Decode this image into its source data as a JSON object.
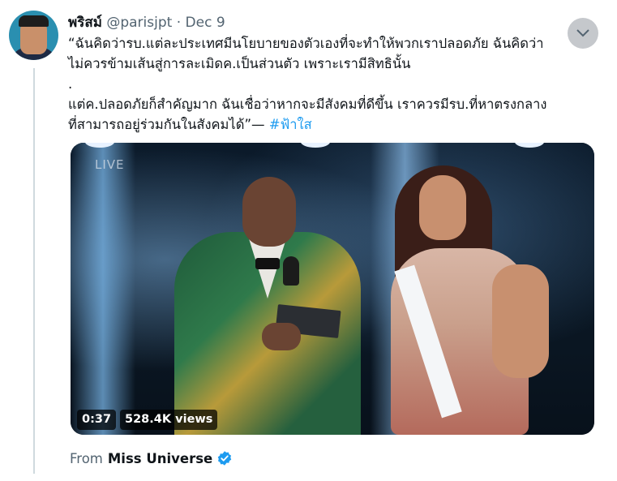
{
  "tweet": {
    "author_name": "พริสม์",
    "handle": "@parisjpt",
    "separator": "·",
    "date": "Dec 9",
    "lines": [
      "“ฉันคิดว่ารบ.แต่ละประเทศมีนโยบายของตัวเองที่จะทำให้พวกเราปลอดภัย ฉันคิดว่า",
      "ไม่ควรข้ามเส้นสู่การละเมิดค.เป็นส่วนตัว เพราะเรามีสิทธินั้น",
      ".",
      "แต่ค.ปลอดภัยก็สำคัญมาก ฉันเชื่อว่าหากจะมีสังคมที่ดีขึ้น เราควรมีรบ.ที่หาตรงกลาง"
    ],
    "last_line_text": "ที่สามารถอยู่ร่วมกันในสังคมได้”— ",
    "hashtag": "#ฟ้าใส"
  },
  "media": {
    "overlay_text": "LIVE",
    "duration": "0:37",
    "views": "528.4K views"
  },
  "source": {
    "label": "From",
    "name": "Miss Universe"
  },
  "icons": {
    "more": "chevron-down-icon",
    "verified": "verified-badge-icon"
  },
  "colors": {
    "link": "#1d9bf0",
    "secondary_text": "#536471",
    "thread_line": "#cfd9de"
  }
}
